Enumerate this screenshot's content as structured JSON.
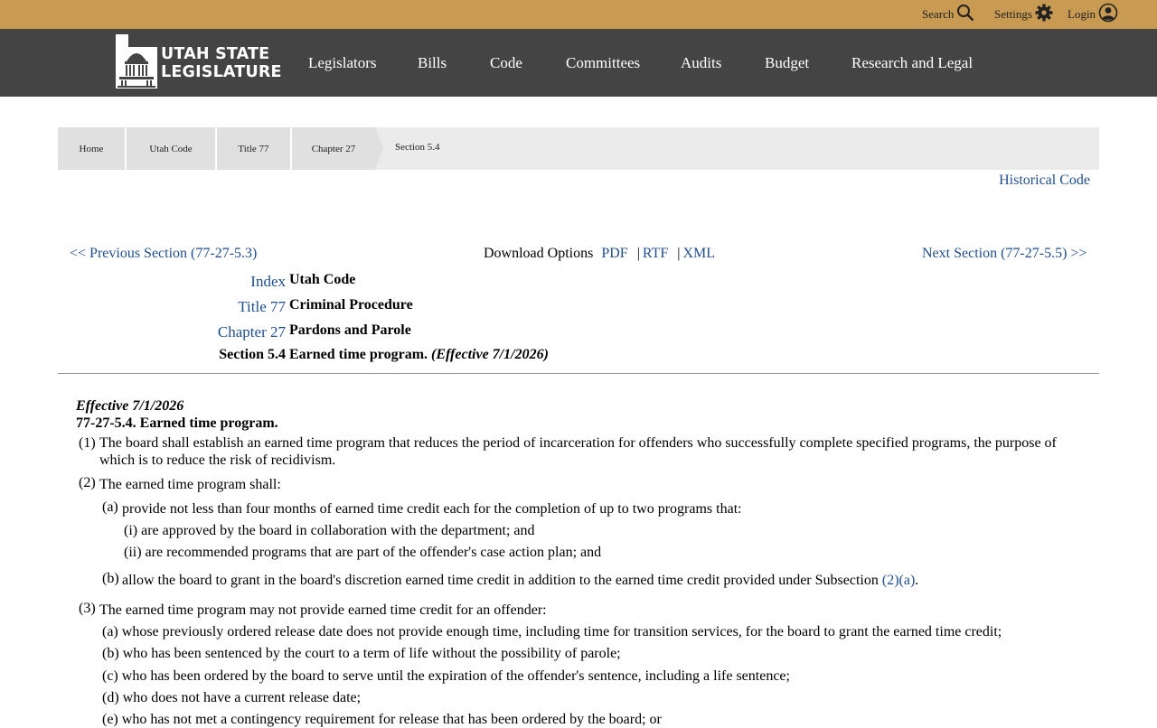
{
  "utility_bar": {
    "search": "Search",
    "settings": "Settings",
    "login": "Login"
  },
  "header": {
    "logo_line1": "UTAH STATE",
    "logo_line2": "LEGISLATURE",
    "nav": [
      "Legislators",
      "Bills",
      "Code",
      "Committees",
      "Audits",
      "Budget",
      "Research and Legal"
    ]
  },
  "breadcrumb": {
    "items": [
      "Home",
      "Utah Code",
      "Title 77",
      "Chapter 27"
    ],
    "current": "Section 5.4"
  },
  "historical_code": "Historical Code",
  "section_nav": {
    "previous": "<< Previous Section (77-27-5.3)",
    "download_label": "Download Options",
    "pdf": "PDF",
    "rtf": "RTF",
    "xml": "XML",
    "next": "Next Section (77-27-5.5) >>"
  },
  "hierarchy": {
    "index_label": "Index",
    "index_value": "Utah Code",
    "title_label": "Title 77",
    "title_value": "Criminal Procedure",
    "chapter_label": "Chapter 27",
    "chapter_value": "Pardons and Parole",
    "section_label": "Section 5.4",
    "section_value": "Earned time program.",
    "section_effective": "(Effective 7/1/2026)"
  },
  "body": {
    "effective": "Effective 7/1/2026",
    "section_heading": "77-27-5.4.  Earned time program.",
    "p1_num": "(1)",
    "p1_text": "The board shall establish an earned time program that reduces the period of incarceration for offenders who successfully complete specified programs, the purpose of which is to reduce the risk of recidivism.",
    "p2_num": "(2)",
    "p2_text": "The earned time program shall:",
    "p2a_num": "(a)",
    "p2a_text": "provide not less than four months of earned time credit each for the completion of up to two programs that:",
    "p2a_i": "(i) are approved by the board in collaboration with the department; and",
    "p2a_ii": "(ii) are recommended programs that are part of the offender's case action plan; and",
    "p2b_num": "(b)",
    "p2b_text": "allow the board to grant in the board's discretion earned time credit in addition to the earned time credit provided under Subsection",
    "p2b_link": "(2)(a)",
    "p2b_end": ".",
    "p3_num": "(3)",
    "p3_text": "The earned time program may not provide earned time credit for an offender:",
    "p3_a": "(a) whose previously ordered release date does not provide enough time, including time for transition services, for the board to grant the earned time credit;",
    "p3_b": "(b) who has been sentenced by the court to a term of life without the possibility of parole;",
    "p3_c": "(c) who has been ordered by the board to serve until the expiration of the offender's sentence, including a life sentence;",
    "p3_d": "(d) who does not have a current release date;",
    "p3_e": "(e) who has not met a contingency requirement for release that has been ordered by the board; or"
  },
  "colors": {
    "utility_bar": "#c99a52",
    "header": "#444444",
    "link": "#1f4e8c"
  }
}
